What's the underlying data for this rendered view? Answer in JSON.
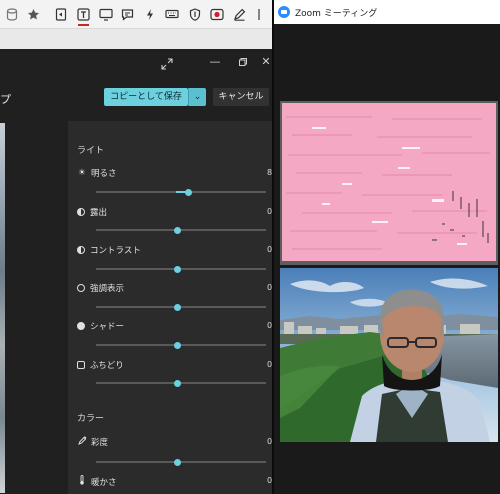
{
  "browser_toolbar": {
    "icons": [
      "database-icon",
      "star-icon",
      "reading-view-icon",
      "text-selection-icon",
      "screen-icon",
      "comment-icon",
      "lightning-icon",
      "keyboard-icon",
      "shield-icon",
      "record-icon",
      "pen-icon",
      "more-icon"
    ]
  },
  "editor": {
    "header_title": "プ",
    "save_label": "コピーとして保存",
    "save_dropdown": "⌄",
    "cancel_label": "キャンセル",
    "sections": [
      {
        "title": "ライト",
        "items": [
          {
            "label": "明るさ",
            "value": "8"
          },
          {
            "label": "露出",
            "value": "0"
          },
          {
            "label": "コントラスト",
            "value": "0"
          },
          {
            "label": "強調表示",
            "value": "0"
          },
          {
            "label": "シャドー",
            "value": "0"
          },
          {
            "label": "ふちどり",
            "value": "0"
          }
        ]
      },
      {
        "title": "カラー",
        "items": [
          {
            "label": "彩度",
            "value": "0"
          },
          {
            "label": "暖かさ",
            "value": "0"
          }
        ]
      }
    ],
    "brightness_level": 0.54
  },
  "zoom": {
    "title": "Zoom ミーティング",
    "accent": "#2d8cff"
  },
  "colors": {
    "accent": "#6cd0df",
    "shared_screen": "#f5a8c4"
  }
}
